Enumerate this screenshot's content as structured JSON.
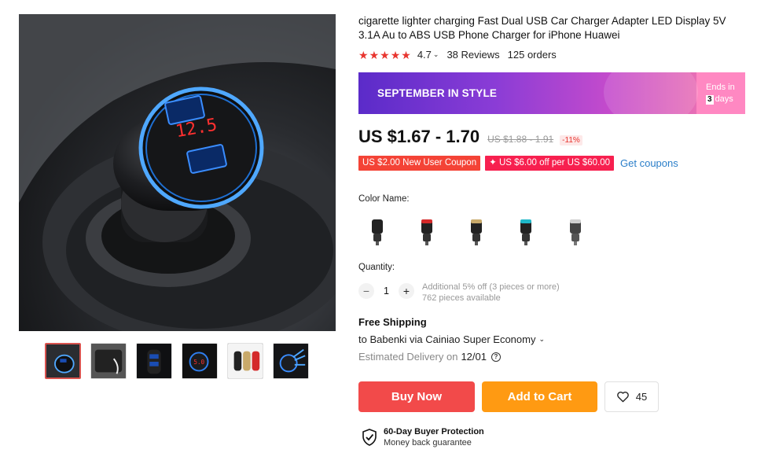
{
  "product": {
    "title": "cigarette lighter charging Fast Dual USB Car Charger Adapter LED Display 5V 3.1A Au to ABS USB Phone Charger for iPhone Huawei",
    "rating": "4.7",
    "rating_value": 4.7,
    "reviews": "38 Reviews",
    "orders": "125 orders",
    "main_image_display": "12.5"
  },
  "promo": {
    "title": "SEPTEMBER IN STYLE",
    "ends_label": "Ends in",
    "days_number": "3",
    "days_label": "days",
    "colors": {
      "start": "#5b2bc9",
      "end": "#ff9fcb",
      "badge": "#ff88c2"
    }
  },
  "pricing": {
    "price": "US $1.67 - 1.70",
    "old_price": "US $1.88 - 1.91",
    "discount": "-11%"
  },
  "coupons": {
    "items": [
      "US $2.00 New User Coupon",
      "US $6.00 off per US $60.00"
    ],
    "get_label": "Get coupons"
  },
  "colors_section": {
    "label": "Color Name:",
    "options": [
      {
        "name": "black",
        "accent": "#222222"
      },
      {
        "name": "red",
        "accent": "#d42a2a"
      },
      {
        "name": "gold",
        "accent": "#c8a96a"
      },
      {
        "name": "blue",
        "accent": "#1fb8c9"
      },
      {
        "name": "silver",
        "accent": "#cfcfcf"
      }
    ]
  },
  "quantity": {
    "label": "Quantity:",
    "minus": "−",
    "plus": "+",
    "value": "1",
    "discount_note": "Additional 5% off (3 pieces or more)",
    "available": "762 pieces available"
  },
  "shipping": {
    "title": "Free Shipping",
    "to": "to Babenki via Cainiao Super Economy",
    "estimated_label": "Estimated Delivery on",
    "estimated_date": "12/01"
  },
  "actions": {
    "buy_now": "Buy Now",
    "add_to_cart": "Add to Cart",
    "wishlist_count": "45"
  },
  "protection": {
    "title": "60-Day Buyer Protection",
    "subtitle": "Money back guarantee"
  },
  "theme": {
    "buy_color": "#f24a4a",
    "cart_color": "#ff9a12",
    "star_color": "#e8352f",
    "link_color": "#2a7ec9"
  }
}
